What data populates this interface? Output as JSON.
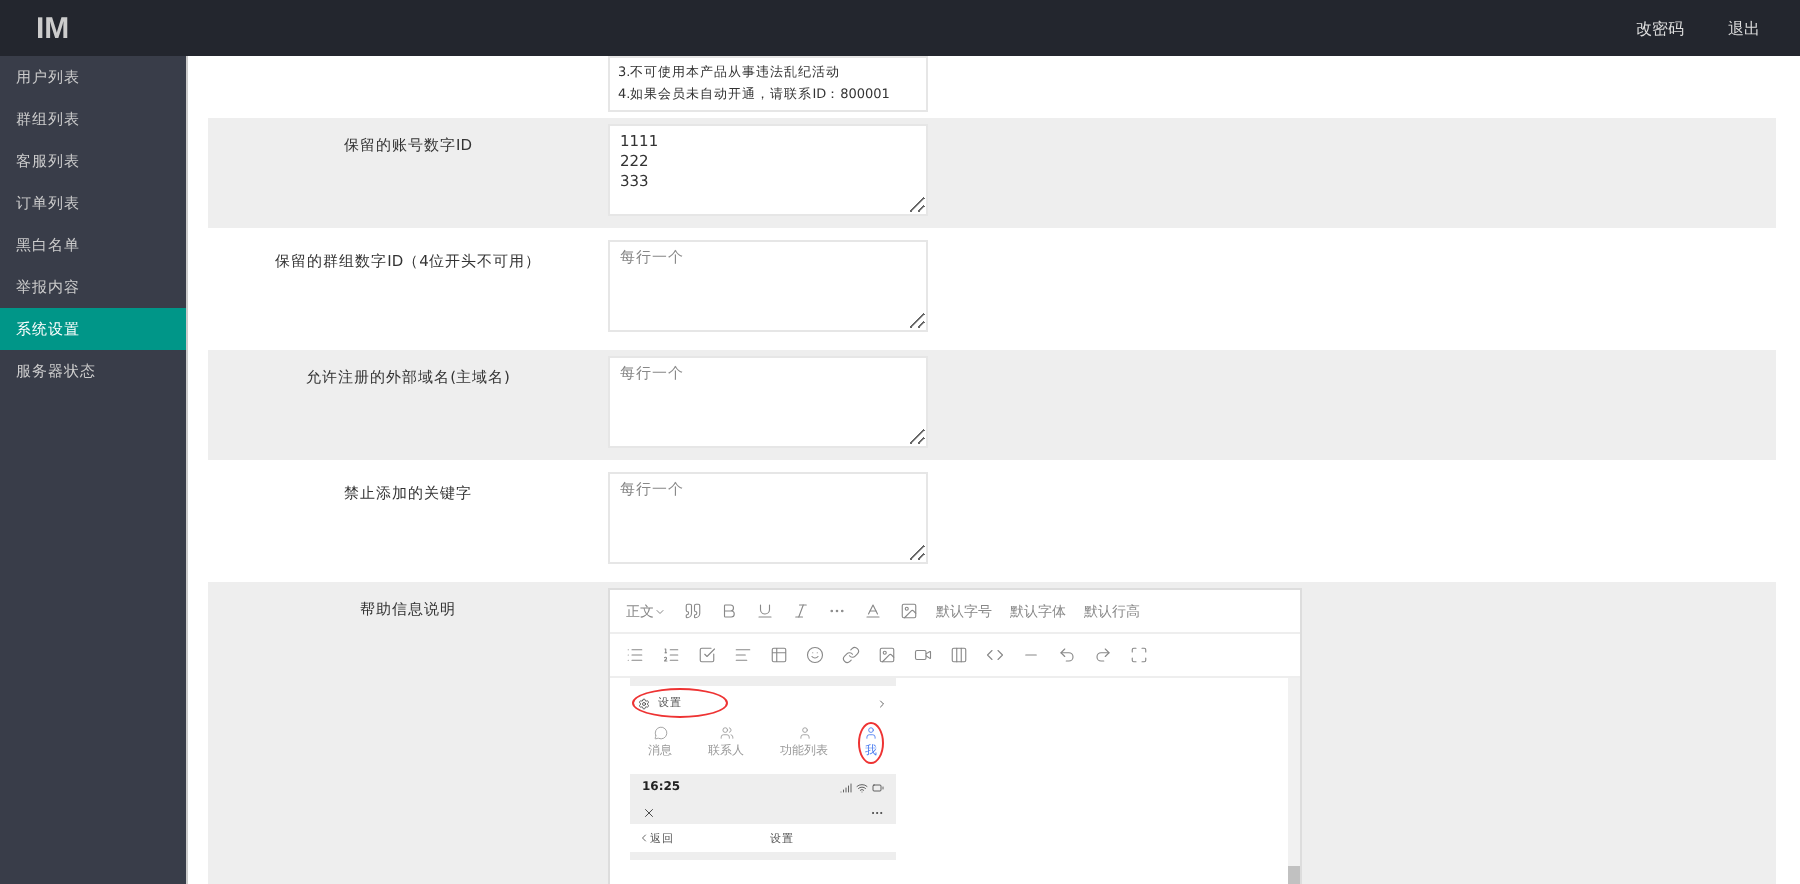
{
  "header": {
    "logo": "IM",
    "links": [
      "改密码",
      "退出"
    ]
  },
  "sidebar": {
    "items": [
      {
        "label": "用户列表",
        "selected": false
      },
      {
        "label": "群组列表",
        "selected": false
      },
      {
        "label": "客服列表",
        "selected": false
      },
      {
        "label": "订单列表",
        "selected": false
      },
      {
        "label": "黑白名单",
        "selected": false
      },
      {
        "label": "举报内容",
        "selected": false
      },
      {
        "label": "系统设置",
        "selected": true
      },
      {
        "label": "服务器状态",
        "selected": false
      }
    ]
  },
  "notice": {
    "lines": [
      "3.不可使用本产品从事违法乱纪活动",
      "4.如果会员未自动开通，请联系ID：800001"
    ]
  },
  "settings": [
    {
      "label": "保留的账号数字ID",
      "kind": "textarea",
      "value": "1111\n222\n333"
    },
    {
      "label": "保留的群组数字ID（4位开头不可用）",
      "kind": "textarea",
      "placeholder": "每行一个"
    },
    {
      "label": "允许注册的外部域名(主域名)",
      "kind": "textarea",
      "placeholder": "每行一个"
    },
    {
      "label": "禁止添加的关键字",
      "kind": "textarea",
      "placeholder": "每行一个"
    },
    {
      "label": "帮助信息说明",
      "kind": "editor",
      "editor": {
        "paragraph": "正文",
        "font_size": "默认字号",
        "font_family": "默认字体",
        "line_height": "默认行高",
        "screenshot": {
          "menu_item": "设置",
          "tabs": [
            {
              "label": "消息",
              "selected": false
            },
            {
              "label": "联系人",
              "selected": false
            },
            {
              "label": "功能列表",
              "selected": false
            },
            {
              "label": "我",
              "selected": true
            }
          ],
          "time": "16:25",
          "back": "返回",
          "title": "设置"
        }
      }
    }
  ]
}
